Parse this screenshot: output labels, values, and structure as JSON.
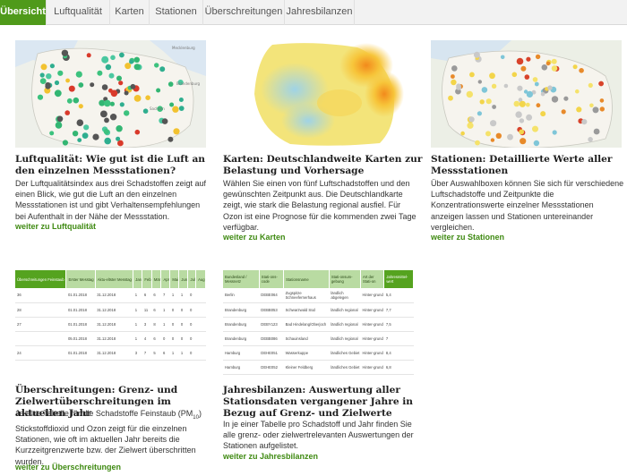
{
  "tabs": [
    {
      "label": "Übersicht",
      "active": true
    },
    {
      "label": "Luftqualität",
      "active": false
    },
    {
      "label": "Karten",
      "active": false
    },
    {
      "label": "Stationen",
      "active": false
    },
    {
      "label": "Überschreitungen",
      "active": false
    },
    {
      "label": "Jahresbilanzen",
      "active": false
    }
  ],
  "colors": {
    "accent": "#4f9a1a",
    "link": "#3f8a12"
  },
  "cards": [
    {
      "title": "Luftqualität: Wie gut ist die Luft an den einzelnen Messstationen?",
      "text": "Der Luftqualitätsindex aus drei Schadstoffen zeigt auf einen Blick, wie gut die Luft an den einzelnen Messstationen ist und gibt Verhaltensempfehlungen bei Aufenthalt in der Nähe der Messstation.",
      "link": "weiter zu Luftqualität"
    },
    {
      "title": "Karten: Deutschlandweite Karten zur Belastung und Vorhersage",
      "text": "Wählen Sie einen von fünf Luftschadstoffen und den gewünschten Zeitpunkt aus. Die Deutschlandkarte zeigt, wie stark die Belastung regional ausfiel. Für Ozon ist eine Prognose für die kommenden zwei Tage verfügbar.",
      "link": "weiter zu Karten"
    },
    {
      "title": "Stationen: Detaillierte Werte aller Messstationen",
      "text": "Über Auswahlboxen können Sie sich für verschiedene Luftschadstoffe und Zeitpunkte die Konzentrationswerte einzelner Messstationen anzeigen lassen und Stationen untereinander vergleichen.",
      "link": "weiter zu Stationen"
    },
    {
      "title": "Überschreitungen: Grenz- und Zielwertüberschreitungen im aktuellen Jahr",
      "text_before_sub": "Je eine Tabelle für die Schadstoffe Feinstaub (PM",
      "text_sub": "10",
      "text_after_sub": ") Stickstoffdioxid und Ozon zeigt für die einzelnen Stationen, wie oft im aktuellen Jahr bereits die Kurzzeitgrenzwerte bzw. der Zielwert überschritten wurden.",
      "link": "weiter zu Überschreitungen"
    },
    {
      "title": "Jahresbilanzen: Auswertung aller Stationsdaten vergangener Jahre in Bezug auf Grenz- und Zielwerte",
      "text": "In je einer Tabelle pro Schadstoff und Jahr finden Sie alle grenz- oder zielwertrelevanten Auswertungen der Stationen aufgelistet.",
      "link": "weiter zu Jahresbilanzen"
    }
  ],
  "thumb_exceed": {
    "headers": [
      "Überschreitungen Feinstaub",
      "Erster Messtag",
      "Aktu-eltster Messtag",
      "Jan",
      "Feb",
      "Mär",
      "Apr",
      "Mai",
      "Jun",
      "Jul",
      "Aug"
    ],
    "rows": [
      [
        "36",
        "01.01.2018",
        "31.12.2018",
        "1",
        "6",
        "6",
        "7",
        "1",
        "1",
        "0",
        ""
      ],
      [
        "28",
        "01.01.2018",
        "31.12.2018",
        "1",
        "11",
        "6",
        "1",
        "0",
        "0",
        "0",
        ""
      ],
      [
        "27",
        "01.01.2018",
        "31.12.2018",
        "1",
        "3",
        "8",
        "1",
        "0",
        "0",
        "0",
        ""
      ],
      [
        "",
        "05.01.2018",
        "31.12.2018",
        "1",
        "4",
        "6",
        "0",
        "0",
        "0",
        "0",
        ""
      ],
      [
        "24",
        "01.01.2018",
        "31.12.2018",
        "3",
        "7",
        "5",
        "6",
        "1",
        "1",
        "0",
        ""
      ]
    ]
  },
  "thumb_annual": {
    "headers": [
      "Bundesland / Messnetz",
      "Stati-ons-code",
      "Stationsname",
      "Stati-onsum-gebung",
      "Art der Stati-on",
      "Jahresmittel-wert"
    ],
    "rows": [
      [
        "Berlin",
        "DEBE064",
        "Zugspitze Schneefernerhaus",
        "ländlich abgelegen",
        "Hinter-grund",
        "5,4"
      ],
      [
        "Brandenburg",
        "DEBB053",
        "Schwarzwald Süd",
        "ländlich regional",
        "Hinter-grund",
        "7,7"
      ],
      [
        "Brandenburg",
        "DEBY123",
        "Bad Hindelang/Oberjoch",
        "ländlich regional",
        "Hinter-grund",
        "7,5"
      ],
      [
        "Brandenburg",
        "DEBB086",
        "Schauinsland",
        "ländlich regional",
        "Hinter-grund",
        "7"
      ],
      [
        "Hamburg",
        "DEHE051",
        "Wasserkuppe",
        "ländliches Gebiet",
        "Hinter-grund",
        "8,4"
      ],
      [
        "Hamburg",
        "DEHE052",
        "Kleiner Feldberg",
        "ländliches Gebiet",
        "Hinter-grund",
        "6,8"
      ]
    ]
  }
}
